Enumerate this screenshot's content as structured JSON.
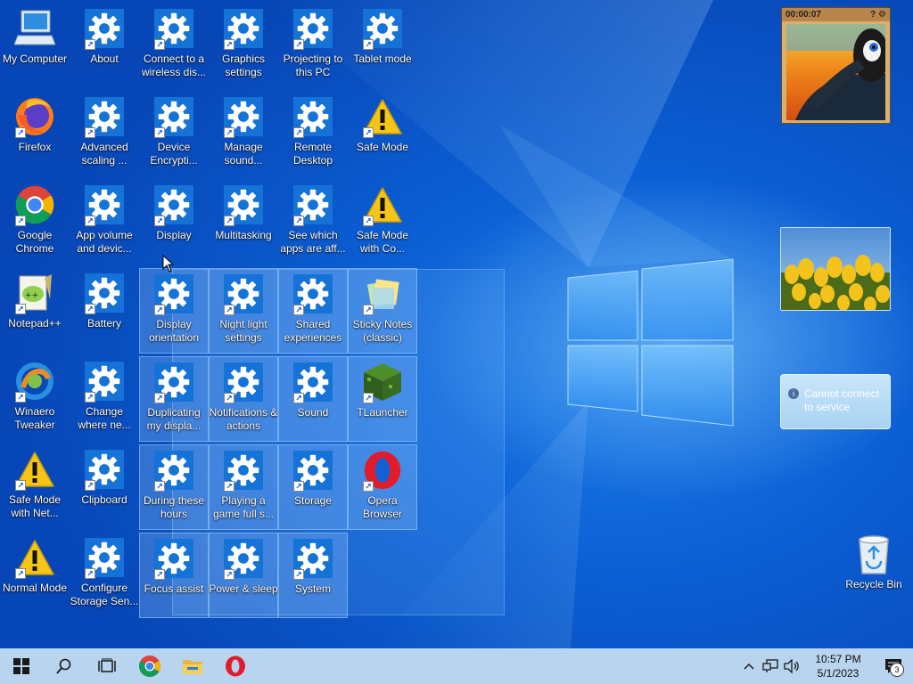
{
  "desktop": {
    "icons": [
      {
        "id": "my-computer",
        "label": "My Computer",
        "icon": "computer-icon",
        "shortcut": false
      },
      {
        "id": "about",
        "label": "About",
        "icon": "settings-gear-icon",
        "shortcut": true
      },
      {
        "id": "connect-wireless",
        "label": "Connect to a wireless dis...",
        "icon": "settings-gear-icon",
        "shortcut": true
      },
      {
        "id": "graphics-settings",
        "label": "Graphics settings",
        "icon": "settings-gear-icon",
        "shortcut": true
      },
      {
        "id": "projecting",
        "label": "Projecting to this PC",
        "icon": "settings-gear-icon",
        "shortcut": true
      },
      {
        "id": "tablet-mode",
        "label": "Tablet mode",
        "icon": "settings-gear-icon",
        "shortcut": true
      },
      {
        "id": "firefox",
        "label": "Firefox",
        "icon": "firefox-icon",
        "shortcut": true
      },
      {
        "id": "advanced-scaling",
        "label": "Advanced scaling ...",
        "icon": "settings-gear-icon",
        "shortcut": true
      },
      {
        "id": "device-encryption",
        "label": "Device Encrypti...",
        "icon": "settings-gear-icon",
        "shortcut": true
      },
      {
        "id": "manage-sound",
        "label": "Manage sound...",
        "icon": "settings-gear-icon",
        "shortcut": true
      },
      {
        "id": "remote-desktop",
        "label": "Remote Desktop",
        "icon": "settings-gear-icon",
        "shortcut": true
      },
      {
        "id": "safe-mode",
        "label": "Safe Mode",
        "icon": "warning-icon",
        "shortcut": true
      },
      {
        "id": "google-chrome",
        "label": "Google Chrome",
        "icon": "chrome-icon",
        "shortcut": true
      },
      {
        "id": "app-volume",
        "label": "App volume and devic...",
        "icon": "settings-gear-icon",
        "shortcut": true
      },
      {
        "id": "display",
        "label": "Display",
        "icon": "settings-gear-icon",
        "shortcut": true
      },
      {
        "id": "multitasking",
        "label": "Multitasking",
        "icon": "settings-gear-icon",
        "shortcut": true
      },
      {
        "id": "see-which-apps",
        "label": "See which apps are aff...",
        "icon": "settings-gear-icon",
        "shortcut": true
      },
      {
        "id": "safe-mode-command",
        "label": "Safe Mode with Co...",
        "icon": "warning-icon",
        "shortcut": true
      },
      {
        "id": "notepad-pp",
        "label": "Notepad++",
        "icon": "notepad-plus-plus-icon",
        "shortcut": true
      },
      {
        "id": "battery",
        "label": "Battery",
        "icon": "settings-gear-icon",
        "shortcut": true
      },
      {
        "id": "display-orientation",
        "label": "Display orientation",
        "icon": "settings-gear-icon",
        "shortcut": true
      },
      {
        "id": "night-light",
        "label": "Night light settings",
        "icon": "settings-gear-icon",
        "shortcut": true
      },
      {
        "id": "shared-experiences",
        "label": "Shared experiences",
        "icon": "settings-gear-icon",
        "shortcut": true
      },
      {
        "id": "sticky-notes",
        "label": "Sticky Notes (classic)",
        "icon": "sticky-notes-icon",
        "shortcut": true
      },
      {
        "id": "winaero-tweaker",
        "label": "Winaero Tweaker",
        "icon": "winaero-icon",
        "shortcut": true
      },
      {
        "id": "change-where",
        "label": "Change where ne...",
        "icon": "settings-gear-icon",
        "shortcut": true
      },
      {
        "id": "duplicating",
        "label": "Duplicating my displa...",
        "icon": "settings-gear-icon",
        "shortcut": true
      },
      {
        "id": "notifications",
        "label": "Notifications & actions",
        "icon": "settings-gear-icon",
        "shortcut": true
      },
      {
        "id": "sound",
        "label": "Sound",
        "icon": "settings-gear-icon",
        "shortcut": true
      },
      {
        "id": "tlauncher",
        "label": "TLauncher",
        "icon": "grass-block-icon",
        "shortcut": true
      },
      {
        "id": "safe-mode-network",
        "label": "Safe Mode with Net...",
        "icon": "warning-icon",
        "shortcut": true
      },
      {
        "id": "clipboard",
        "label": "Clipboard",
        "icon": "settings-gear-icon",
        "shortcut": true
      },
      {
        "id": "during-these-hours",
        "label": "During these hours",
        "icon": "settings-gear-icon",
        "shortcut": true
      },
      {
        "id": "playing-game",
        "label": "Playing a game full s...",
        "icon": "settings-gear-icon",
        "shortcut": true
      },
      {
        "id": "storage",
        "label": "Storage",
        "icon": "settings-gear-icon",
        "shortcut": true
      },
      {
        "id": "opera-browser",
        "label": "Opera Browser",
        "icon": "opera-icon",
        "shortcut": true
      },
      {
        "id": "normal-mode",
        "label": "Normal Mode",
        "icon": "warning-icon",
        "shortcut": true
      },
      {
        "id": "configure-storage",
        "label": "Configure Storage Sen...",
        "icon": "settings-gear-icon",
        "shortcut": true
      },
      {
        "id": "focus-assist",
        "label": "Focus assist",
        "icon": "settings-gear-icon",
        "shortcut": true
      },
      {
        "id": "power-sleep",
        "label": "Power & sleep",
        "icon": "settings-gear-icon",
        "shortcut": true
      },
      {
        "id": "system",
        "label": "System",
        "icon": "settings-gear-icon",
        "shortcut": true
      }
    ],
    "recycle_bin": {
      "label": "Recycle Bin",
      "icon": "recycle-bin-icon"
    }
  },
  "gadgets": {
    "clock_timer": "00:00:07",
    "slideshow": {
      "icon": "tulips-photo"
    },
    "weather": {
      "message": "Cannot connect to service",
      "icon": "info-icon"
    }
  },
  "taskbar": {
    "buttons": [
      {
        "id": "start",
        "icon": "windows-logo-icon"
      },
      {
        "id": "search",
        "icon": "search-icon"
      },
      {
        "id": "task-view",
        "icon": "task-view-icon"
      },
      {
        "id": "chrome",
        "icon": "chrome-icon"
      },
      {
        "id": "file-explorer",
        "icon": "folder-icon"
      },
      {
        "id": "opera",
        "icon": "opera-icon"
      }
    ],
    "tray": {
      "time": "10:57 PM",
      "date": "5/1/2023",
      "notification_count": "3"
    }
  },
  "colors": {
    "taskbar": "#b8d4ee",
    "settings_tile": "#1573d8",
    "warning": "#f5c518",
    "desktop": "#0b5fd4"
  }
}
